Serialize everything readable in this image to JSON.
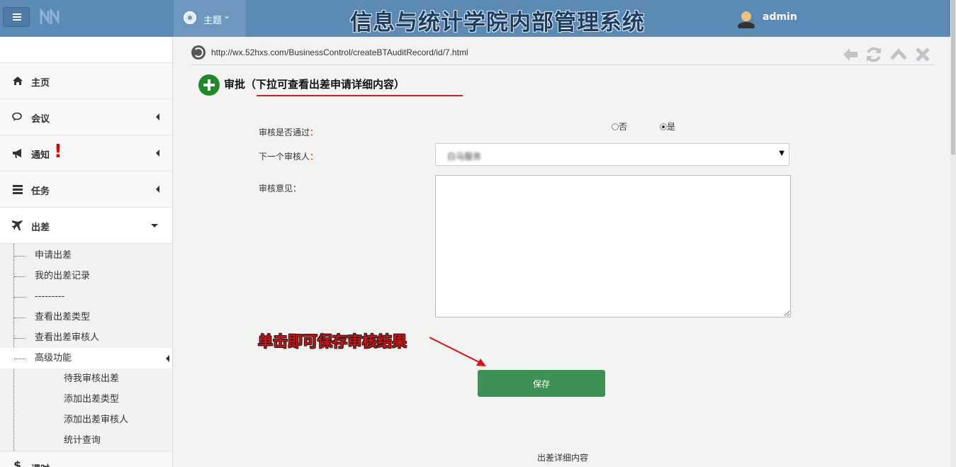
{
  "header": {
    "theme_label": "主题",
    "theme_caret": "⌄",
    "app_title": "信息与统计学院内部管理系统",
    "user_name": "admin"
  },
  "sidebar": {
    "items": [
      {
        "label": "主页",
        "icon": "home-icon"
      },
      {
        "label": "会议",
        "icon": "comments-icon"
      },
      {
        "label": "通知",
        "icon": "bullhorn-icon",
        "alert": "!"
      },
      {
        "label": "任务",
        "icon": "tasks-icon"
      },
      {
        "label": "出差",
        "icon": "plane-icon"
      }
    ],
    "trip_sub_items": [
      "申请出差",
      "我的出差记录",
      "---------",
      "查看出差类型",
      "查看出差审核人",
      "高级功能"
    ],
    "advanced_sub_items": [
      "待我审核出差",
      "添加出差类型",
      "添加出差审核人",
      "统计查询"
    ],
    "next_item_label": "课时"
  },
  "content": {
    "url": "http://wx.52hxs.com/BusinessControl/createBTAuditRecord/id/7.html",
    "approve_title": "审批",
    "approve_note": "（下拉可查看出差申请详细内容）",
    "form": {
      "pass_label": "审核是否通过",
      "option_no": "否",
      "option_yes": "是",
      "selected": "是",
      "next_reviewer_label": "下一个审核人",
      "next_reviewer_value": "白马服务",
      "opinion_label": "审核意见",
      "colon": "：",
      "opinion_value": ""
    },
    "hint_text": "单击即可保存审核结果",
    "save_label": "保存",
    "detail_label": "出差详细内容"
  },
  "colors": {
    "topbar": "#5b8ab5",
    "save_button": "#3d9156",
    "approve_icon": "#1d8a2a",
    "hint_red": "#cc1111"
  }
}
